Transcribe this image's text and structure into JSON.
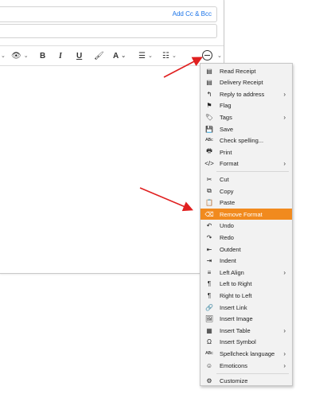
{
  "compose": {
    "add_cc_bcc": "Add Cc & Bcc"
  },
  "toolbar": {
    "items": [
      {
        "name": "view-icon",
        "glyph": "👁"
      },
      {
        "name": "bold",
        "label": "B"
      },
      {
        "name": "italic",
        "label": "I"
      },
      {
        "name": "underline",
        "label": "U"
      },
      {
        "name": "font-color",
        "label": "A"
      }
    ]
  },
  "menu": {
    "items": [
      {
        "label": "Read Receipt",
        "icon": "receipt-icon",
        "glyph": "▤",
        "submenu": false
      },
      {
        "label": "Delivery Receipt",
        "icon": "delivery-receipt-icon",
        "glyph": "▤",
        "submenu": false
      },
      {
        "label": "Reply to address",
        "icon": "reply-icon",
        "glyph": "↰",
        "submenu": true
      },
      {
        "label": "Flag",
        "icon": "flag-icon",
        "glyph": "⚑",
        "submenu": false
      },
      {
        "label": "Tags",
        "icon": "tag-icon",
        "glyph": "🏷",
        "submenu": true
      },
      {
        "label": "Save",
        "icon": "save-icon",
        "glyph": "💾",
        "submenu": false
      },
      {
        "label": "Check spelling...",
        "icon": "spellcheck-icon",
        "glyph": "ᴬᴮᶜ",
        "submenu": false
      },
      {
        "label": "Print",
        "icon": "print-icon",
        "glyph": "🖶",
        "submenu": false
      },
      {
        "label": "Format",
        "icon": "code-icon",
        "glyph": "</>",
        "submenu": true
      },
      {
        "label": "Cut",
        "icon": "scissors-icon",
        "glyph": "✂",
        "submenu": false
      },
      {
        "label": "Copy",
        "icon": "copy-icon",
        "glyph": "⧉",
        "submenu": false
      },
      {
        "label": "Paste",
        "icon": "paste-icon",
        "glyph": "📋",
        "submenu": false
      },
      {
        "label": "Remove Format",
        "icon": "eraser-icon",
        "glyph": "⌫",
        "submenu": false,
        "highlighted": true
      },
      {
        "label": "Undo",
        "icon": "undo-icon",
        "glyph": "↶",
        "submenu": false
      },
      {
        "label": "Redo",
        "icon": "redo-icon",
        "glyph": "↷",
        "submenu": false
      },
      {
        "label": "Outdent",
        "icon": "outdent-icon",
        "glyph": "⇤",
        "submenu": false
      },
      {
        "label": "Indent",
        "icon": "indent-icon",
        "glyph": "⇥",
        "submenu": false
      },
      {
        "label": "Left Align",
        "icon": "align-left-icon",
        "glyph": "≡",
        "submenu": true
      },
      {
        "label": "Left to Right",
        "icon": "ltr-icon",
        "glyph": "¶",
        "submenu": false
      },
      {
        "label": "Right to Left",
        "icon": "rtl-icon",
        "glyph": "¶",
        "submenu": false
      },
      {
        "label": "Insert Link",
        "icon": "link-icon",
        "glyph": "🔗",
        "submenu": false
      },
      {
        "label": "Insert Image",
        "icon": "image-icon",
        "glyph": "🖼",
        "submenu": false
      },
      {
        "label": "Insert Table",
        "icon": "table-icon",
        "glyph": "▦",
        "submenu": true
      },
      {
        "label": "Insert Symbol",
        "icon": "omega-icon",
        "glyph": "Ω",
        "submenu": false
      },
      {
        "label": "Spellcheck language",
        "icon": "spellcheck-language-icon",
        "glyph": "ᴬᴮᶜ",
        "submenu": true
      },
      {
        "label": "Emoticons",
        "icon": "emoticon-icon",
        "glyph": "☺",
        "submenu": true
      },
      {
        "label": "Customize",
        "icon": "gear-icon",
        "glyph": "⚙",
        "submenu": false
      }
    ]
  },
  "colors": {
    "highlight": "#f18a1e",
    "arrow": "#e02020",
    "link": "#1a73e8"
  }
}
